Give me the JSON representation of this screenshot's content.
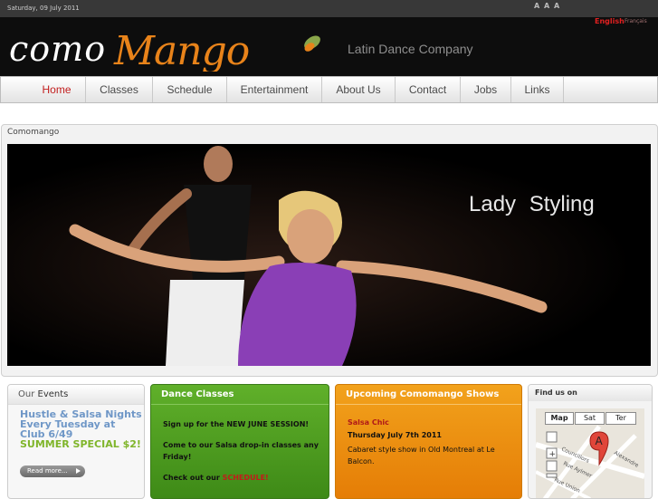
{
  "topbar": {
    "date": "Saturday, 09 July 2011",
    "font_size_buttons": [
      "A",
      "A",
      "A"
    ]
  },
  "header": {
    "logo_text": "comoMango",
    "logo_left": "como",
    "logo_right": "Mango",
    "tagline": "Latin Dance Company",
    "lang_english": "English",
    "lang_french": "Français"
  },
  "nav": {
    "items": [
      {
        "label": "Home",
        "active": true
      },
      {
        "label": "Classes",
        "active": false
      },
      {
        "label": "Schedule",
        "active": false
      },
      {
        "label": "Entertainment",
        "active": false
      },
      {
        "label": "About Us",
        "active": false
      },
      {
        "label": "Contact",
        "active": false
      },
      {
        "label": "Jobs",
        "active": false
      },
      {
        "label": "Links",
        "active": false
      }
    ]
  },
  "main": {
    "title": "Comomango",
    "hero_caption": "Lady  Styling"
  },
  "events": {
    "title_our": "Our",
    "title_events": "Events",
    "line1": "Hustle & Salsa Nights",
    "line2": "Every Tuesday at",
    "line3": "Club 6/49",
    "special": "SUMMER SPECIAL $2!",
    "read_more": "Read more..."
  },
  "classes": {
    "title": "Dance Classes",
    "p1": "Sign up for the NEW JUNE SESSION!",
    "p2": "Come to our Salsa drop-in classes any Friday!",
    "p3_prefix": "Check out our ",
    "p3_link": "SCHEDULE!"
  },
  "shows": {
    "title": "Upcoming Comomango Shows",
    "name": "Salsa Chic",
    "date": "Thursday July 7th 2011",
    "desc": "Cabaret style show in Old Montreal at Le Balcon."
  },
  "map": {
    "title": "Find us on",
    "tabs": [
      "Map",
      "Sat",
      "Ter"
    ],
    "marker": "A",
    "streets": [
      "Councillors",
      "Rue Aylmer",
      "Rue Union",
      "Alexandre"
    ]
  },
  "colors": {
    "accent_red": "#c21e1e",
    "green_box": "#4e9e22",
    "orange_box": "#ee8c10",
    "events_blue": "#6f97c7",
    "logo_orange": "#e8831a"
  }
}
